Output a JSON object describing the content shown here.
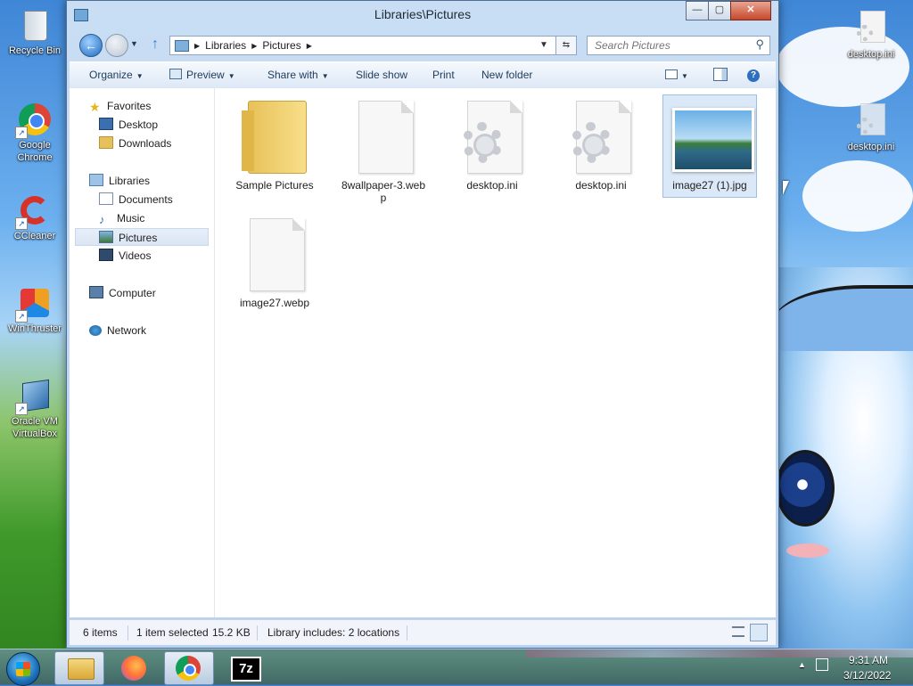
{
  "desktop": {
    "icons": [
      {
        "label": "Recycle Bin"
      },
      {
        "label": "Google Chrome"
      },
      {
        "label": "CCleaner"
      },
      {
        "label": "WinThruster"
      },
      {
        "label": "Oracle VM VirtualBox"
      },
      {
        "label": "desktop.ini"
      },
      {
        "label": "desktop.ini"
      }
    ]
  },
  "window": {
    "title": "Libraries\\Pictures",
    "buttons": {
      "minimize": "—",
      "maximize": "▢",
      "close": "✕"
    }
  },
  "address": {
    "crumbs": [
      "Libraries",
      "Pictures"
    ],
    "search_placeholder": "Search Pictures"
  },
  "toolbar": {
    "organize": "Organize",
    "preview": "Preview",
    "share_with": "Share with",
    "slide_show": "Slide show",
    "print": "Print",
    "new_folder": "New folder"
  },
  "nav": {
    "favorites": "Favorites",
    "desktop": "Desktop",
    "downloads": "Downloads",
    "libraries": "Libraries",
    "documents": "Documents",
    "music": "Music",
    "pictures": "Pictures",
    "videos": "Videos",
    "computer": "Computer",
    "network": "Network"
  },
  "files": [
    {
      "name": "Sample Pictures",
      "type": "folder"
    },
    {
      "name": "8wallpaper-3.webp",
      "type": "file"
    },
    {
      "name": "desktop.ini",
      "type": "settings"
    },
    {
      "name": "desktop.ini",
      "type": "settings"
    },
    {
      "name": "image27 (1).jpg",
      "type": "image",
      "selected": true
    },
    {
      "name": "image27.webp",
      "type": "file"
    }
  ],
  "status": {
    "count": "6 items",
    "selection": "1 item selected",
    "size": "15.2 KB",
    "library": "Library includes: 2 locations"
  },
  "taskbar": {
    "apps": [
      "explorer",
      "firefox",
      "chrome",
      "7-zip"
    ],
    "app_label_7z": "7z",
    "time": "9:31 AM",
    "date": "3/12/2022"
  }
}
